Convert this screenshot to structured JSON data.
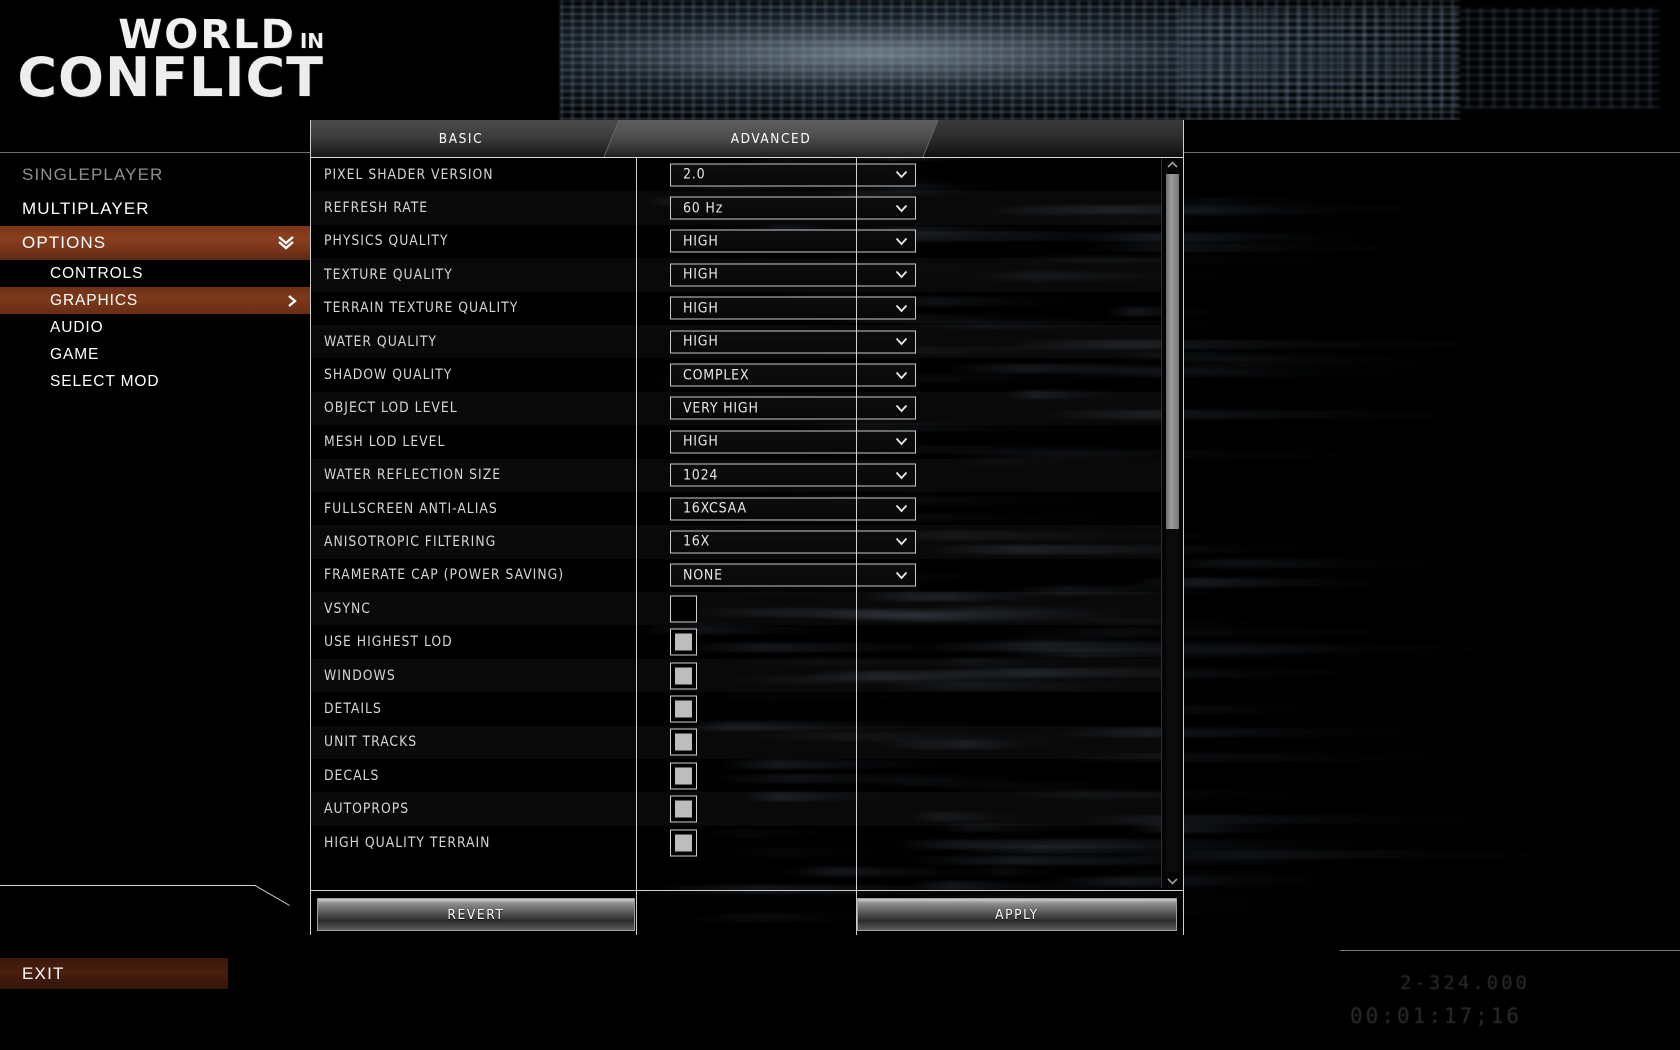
{
  "branding": {
    "title_line1": "WORLD",
    "title_in": "in",
    "title_line2": "CONFLICT"
  },
  "sidebar": {
    "items": [
      {
        "label": "SINGLEPLAYER",
        "state": "dim"
      },
      {
        "label": "MULTIPLAYER",
        "state": "normal"
      },
      {
        "label": "OPTIONS",
        "state": "active",
        "icon": "chevron-down-icon"
      }
    ],
    "sub_items": [
      {
        "label": "CONTROLS",
        "state": "normal"
      },
      {
        "label": "GRAPHICS",
        "state": "active",
        "icon": "chevron-right-icon"
      },
      {
        "label": "AUDIO",
        "state": "normal"
      },
      {
        "label": "GAME",
        "state": "normal"
      },
      {
        "label": "SELECT MOD",
        "state": "normal"
      }
    ],
    "exit_label": "EXIT"
  },
  "tabs": [
    {
      "label": "BASIC",
      "active": false
    },
    {
      "label": "ADVANCED",
      "active": true
    }
  ],
  "settings": [
    {
      "label": "PIXEL SHADER VERSION",
      "type": "select",
      "value": "2.0"
    },
    {
      "label": "REFRESH RATE",
      "type": "select",
      "value": "60 Hz"
    },
    {
      "label": "PHYSICS QUALITY",
      "type": "select",
      "value": "HIGH"
    },
    {
      "label": "TEXTURE QUALITY",
      "type": "select",
      "value": "HIGH"
    },
    {
      "label": "TERRAIN TEXTURE QUALITY",
      "type": "select",
      "value": "HIGH"
    },
    {
      "label": "WATER QUALITY",
      "type": "select",
      "value": "HIGH"
    },
    {
      "label": "SHADOW QUALITY",
      "type": "select",
      "value": "COMPLEX"
    },
    {
      "label": "OBJECT LOD LEVEL",
      "type": "select",
      "value": "VERY HIGH"
    },
    {
      "label": "MESH LOD LEVEL",
      "type": "select",
      "value": "HIGH"
    },
    {
      "label": "WATER REFLECTION SIZE",
      "type": "select",
      "value": "1024"
    },
    {
      "label": "FULLSCREEN ANTI-ALIAS",
      "type": "select",
      "value": "16XCSAA"
    },
    {
      "label": "ANISOTROPIC FILTERING",
      "type": "select",
      "value": "16X"
    },
    {
      "label": "FRAMERATE CAP (POWER SAVING)",
      "type": "select",
      "value": "NONE"
    },
    {
      "label": "VSYNC",
      "type": "checkbox",
      "checked": false
    },
    {
      "label": "USE HIGHEST LOD",
      "type": "checkbox",
      "checked": true
    },
    {
      "label": "WINDOWS",
      "type": "checkbox",
      "checked": true
    },
    {
      "label": "DETAILS",
      "type": "checkbox",
      "checked": true
    },
    {
      "label": "UNIT TRACKS",
      "type": "checkbox",
      "checked": true
    },
    {
      "label": "DECALS",
      "type": "checkbox",
      "checked": true
    },
    {
      "label": "AUTOPROPS",
      "type": "checkbox",
      "checked": true
    },
    {
      "label": "HIGH QUALITY TERRAIN",
      "type": "checkbox",
      "checked": true
    }
  ],
  "scrollbar": {
    "up_icon": "chevron-up-icon",
    "down_icon": "chevron-down-icon"
  },
  "footer": {
    "revert_label": "REVERT",
    "apply_label": "APPLY"
  },
  "background_readout": {
    "line1": "2-324.000",
    "line2": "00:01:17;16"
  },
  "colors": {
    "accent": "#89401f",
    "accent_sub": "#7d3a1b",
    "exit": "#4a1f0e",
    "text": "#d6d6d6"
  }
}
